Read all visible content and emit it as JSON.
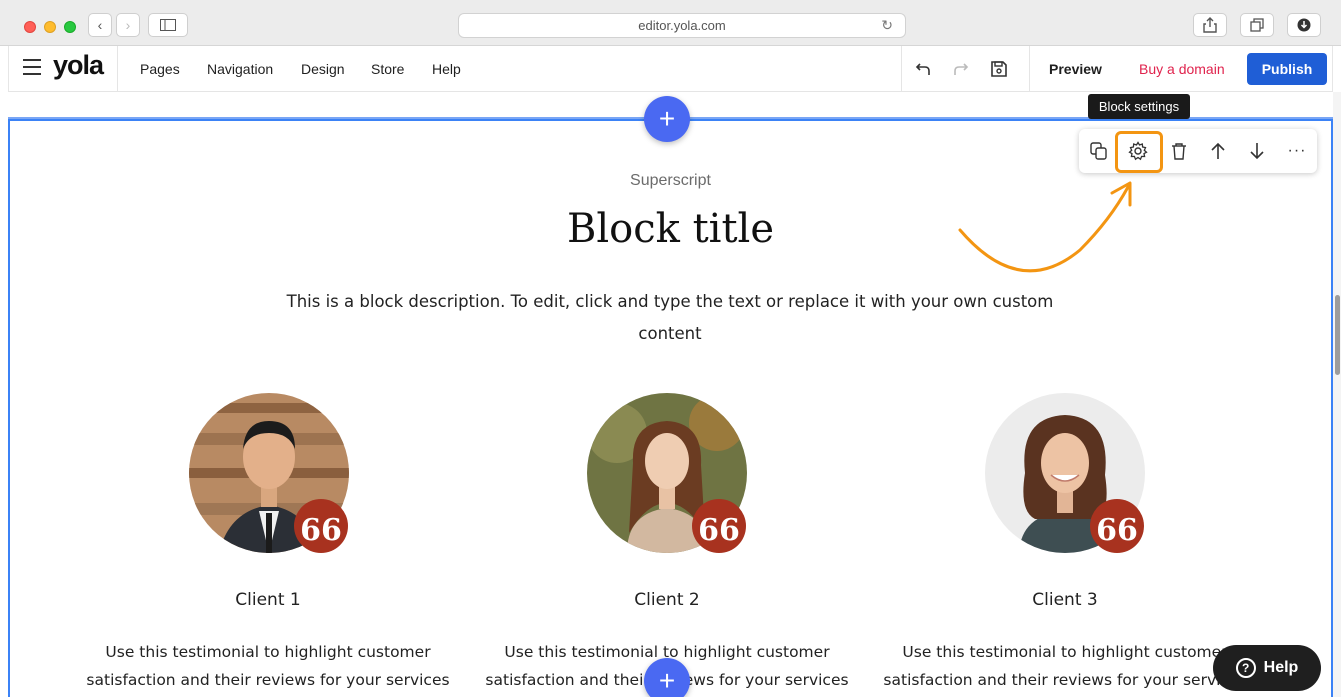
{
  "browser": {
    "address": "editor.yola.com"
  },
  "editor": {
    "logo": "yola",
    "nav": [
      "Pages",
      "Navigation",
      "Design",
      "Store",
      "Help"
    ],
    "preview_label": "Preview",
    "buy_domain_label": "Buy a domain",
    "publish_label": "Publish"
  },
  "block_toolbar": {
    "tooltip": "Block settings"
  },
  "block": {
    "superscript": "Superscript",
    "title": "Block title",
    "description": "This is a block description. To edit, click and type the text or replace it with your own custom content",
    "clients": [
      {
        "name": "Client 1",
        "text": "Use this testimonial to highlight customer satisfaction and their reviews for your services"
      },
      {
        "name": "Client 2",
        "text": "Use this testimonial to highlight customer satisfaction and their reviews for your services"
      },
      {
        "name": "Client 3",
        "text": "Use this testimonial to highlight customer satisfaction and their reviews for your services"
      }
    ],
    "quote_glyph": "66"
  },
  "help_widget": {
    "label": "Help",
    "icon": "?"
  },
  "colors": {
    "publish": "#1f5ed6",
    "buy_domain": "#e0234d",
    "add_button": "#4a69f2",
    "quote_badge": "#a8321f",
    "highlight": "#f39512"
  }
}
